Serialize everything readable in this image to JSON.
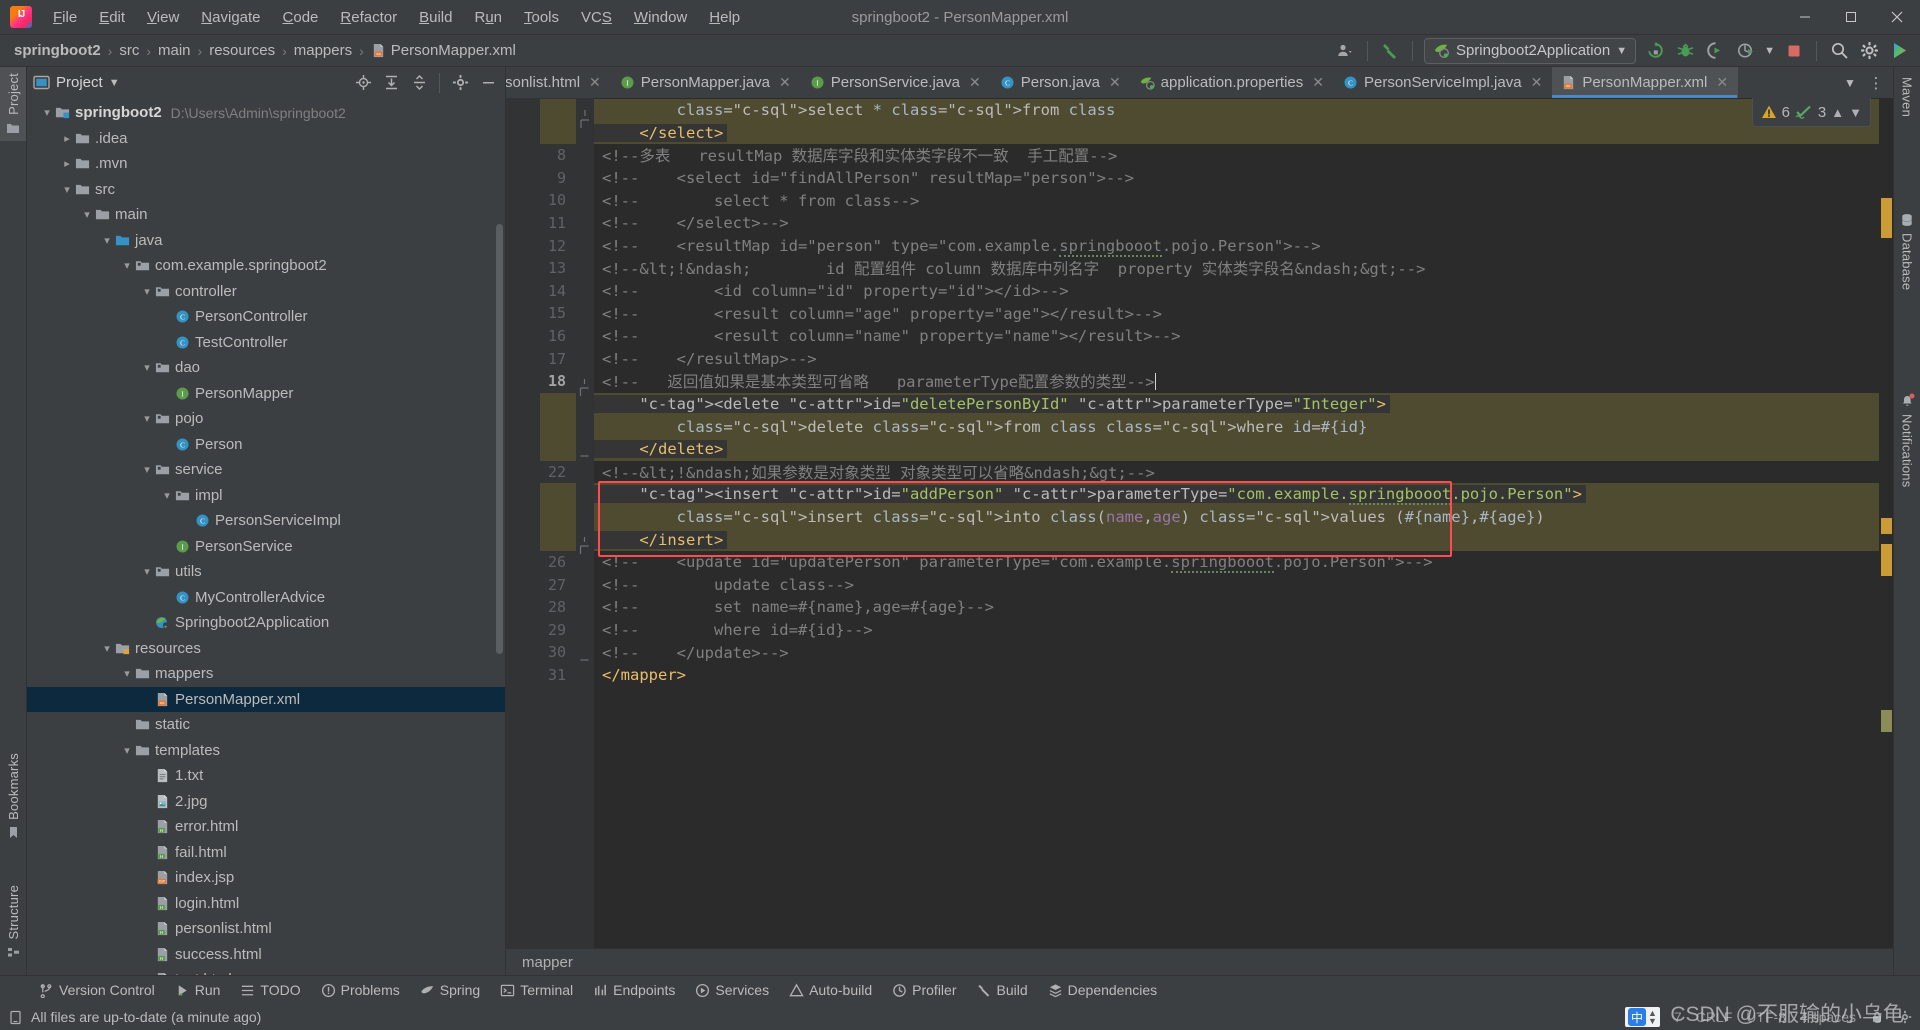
{
  "window": {
    "title": "springboot2 - PersonMapper.xml",
    "minimize_label": "—",
    "maximize_label": "❐",
    "close_label": "✕"
  },
  "menubar": {
    "logo": "intellij-idea-logo",
    "items": [
      {
        "label": "File",
        "mnemonic": "F"
      },
      {
        "label": "Edit",
        "mnemonic": "E"
      },
      {
        "label": "View",
        "mnemonic": "V"
      },
      {
        "label": "Navigate",
        "mnemonic": "N"
      },
      {
        "label": "Code",
        "mnemonic": "C"
      },
      {
        "label": "Refactor",
        "mnemonic": "R"
      },
      {
        "label": "Build",
        "mnemonic": "B"
      },
      {
        "label": "Run",
        "mnemonic": "u"
      },
      {
        "label": "Tools",
        "mnemonic": "T"
      },
      {
        "label": "VCS",
        "mnemonic": "S"
      },
      {
        "label": "Window",
        "mnemonic": "W"
      },
      {
        "label": "Help",
        "mnemonic": "H"
      }
    ]
  },
  "navbar": {
    "crumbs": [
      "springboot2",
      "src",
      "main",
      "resources",
      "mappers",
      "PersonMapper.xml"
    ],
    "separator": "›",
    "run_config": "Springboot2Application",
    "icons": [
      "user-accounts-icon",
      "hammer-build-icon",
      "rerun-icon",
      "debug-icon",
      "run-with-coverage-icon",
      "profile-icon",
      "stop-icon",
      "search-icon",
      "settings-gear-icon",
      "ide-assistant-icon"
    ]
  },
  "left_strip": {
    "tabs": [
      {
        "label": "Project",
        "icon": "project-folder-icon",
        "active": true
      },
      {
        "label": "Bookmarks",
        "icon": "bookmark-icon",
        "active": false
      },
      {
        "label": "Structure",
        "icon": "structure-icon",
        "active": false
      }
    ]
  },
  "right_strip": {
    "tabs": [
      {
        "label": "Maven",
        "icon": "maven-icon"
      },
      {
        "label": "Database",
        "icon": "database-icon"
      },
      {
        "label": "Notifications",
        "icon": "bell-icon",
        "badge": true
      }
    ]
  },
  "project_panel": {
    "title": "Project",
    "dropdown": "▾",
    "header_icons": [
      "select-opened-file-icon",
      "expand-all-icon",
      "collapse-all-icon",
      "settings-gear-icon",
      "hide-icon"
    ],
    "tree": [
      {
        "depth": 0,
        "arrow": "open",
        "icon": "module-icon",
        "label": "springboot2",
        "path": "D:\\Users\\Admin\\springboot2",
        "bold": true
      },
      {
        "depth": 1,
        "arrow": "closed",
        "icon": "folder-icon",
        "label": ".idea"
      },
      {
        "depth": 1,
        "arrow": "closed",
        "icon": "folder-icon",
        "label": ".mvn"
      },
      {
        "depth": 1,
        "arrow": "open",
        "icon": "folder-icon",
        "label": "src"
      },
      {
        "depth": 2,
        "arrow": "open",
        "icon": "folder-icon",
        "label": "main"
      },
      {
        "depth": 3,
        "arrow": "open",
        "icon": "source-root-icon",
        "label": "java"
      },
      {
        "depth": 4,
        "arrow": "open",
        "icon": "package-icon",
        "label": "com.example.springboot2"
      },
      {
        "depth": 5,
        "arrow": "open",
        "icon": "package-icon",
        "label": "controller"
      },
      {
        "depth": 6,
        "arrow": "none",
        "icon": "class-icon",
        "label": "PersonController"
      },
      {
        "depth": 6,
        "arrow": "none",
        "icon": "class-icon",
        "label": "TestController"
      },
      {
        "depth": 5,
        "arrow": "open",
        "icon": "package-icon",
        "label": "dao"
      },
      {
        "depth": 6,
        "arrow": "none",
        "icon": "interface-icon",
        "label": "PersonMapper"
      },
      {
        "depth": 5,
        "arrow": "open",
        "icon": "package-icon",
        "label": "pojo"
      },
      {
        "depth": 6,
        "arrow": "none",
        "icon": "class-icon",
        "label": "Person"
      },
      {
        "depth": 5,
        "arrow": "open",
        "icon": "package-icon",
        "label": "service"
      },
      {
        "depth": 6,
        "arrow": "open",
        "icon": "package-icon",
        "label": "impl"
      },
      {
        "depth": 7,
        "arrow": "none",
        "icon": "class-icon",
        "label": "PersonServiceImpl"
      },
      {
        "depth": 6,
        "arrow": "none",
        "icon": "interface-icon",
        "label": "PersonService"
      },
      {
        "depth": 5,
        "arrow": "open",
        "icon": "package-icon",
        "label": "utils"
      },
      {
        "depth": 6,
        "arrow": "none",
        "icon": "class-icon",
        "label": "MyControllerAdvice"
      },
      {
        "depth": 5,
        "arrow": "none",
        "icon": "spring-class-icon",
        "label": "Springboot2Application"
      },
      {
        "depth": 3,
        "arrow": "open",
        "icon": "resource-root-icon",
        "label": "resources"
      },
      {
        "depth": 4,
        "arrow": "open",
        "icon": "folder-icon",
        "label": "mappers"
      },
      {
        "depth": 5,
        "arrow": "none",
        "icon": "xml-file-icon",
        "label": "PersonMapper.xml",
        "selected": true
      },
      {
        "depth": 4,
        "arrow": "none",
        "icon": "folder-icon",
        "label": "static"
      },
      {
        "depth": 4,
        "arrow": "open",
        "icon": "folder-icon",
        "label": "templates"
      },
      {
        "depth": 5,
        "arrow": "none",
        "icon": "text-file-icon",
        "label": "1.txt"
      },
      {
        "depth": 5,
        "arrow": "none",
        "icon": "image-file-icon",
        "label": "2.jpg"
      },
      {
        "depth": 5,
        "arrow": "none",
        "icon": "html-file-icon",
        "label": "error.html"
      },
      {
        "depth": 5,
        "arrow": "none",
        "icon": "html-file-icon",
        "label": "fail.html"
      },
      {
        "depth": 5,
        "arrow": "none",
        "icon": "jsp-file-icon",
        "label": "index.jsp"
      },
      {
        "depth": 5,
        "arrow": "none",
        "icon": "html-file-icon",
        "label": "login.html"
      },
      {
        "depth": 5,
        "arrow": "none",
        "icon": "html-file-icon",
        "label": "personlist.html"
      },
      {
        "depth": 5,
        "arrow": "none",
        "icon": "html-file-icon",
        "label": "success.html"
      },
      {
        "depth": 5,
        "arrow": "none",
        "icon": "html-file-icon",
        "label": "test.html"
      }
    ]
  },
  "editor": {
    "tabs": [
      {
        "label": "sonlist.html",
        "icon": "html-file-icon",
        "active": false,
        "clipped": true
      },
      {
        "label": "PersonMapper.java",
        "icon": "interface-icon",
        "active": false
      },
      {
        "label": "PersonService.java",
        "icon": "interface-icon",
        "active": false
      },
      {
        "label": "Person.java",
        "icon": "class-icon",
        "active": false
      },
      {
        "label": "application.properties",
        "icon": "spring-properties-icon",
        "active": false
      },
      {
        "label": "PersonServiceImpl.java",
        "icon": "class-icon",
        "active": false
      },
      {
        "label": "PersonMapper.xml",
        "icon": "xml-file-icon",
        "active": true
      }
    ],
    "tab_overflow_icon": "chevron-down-icon",
    "tab_options_icon": "more-vertical-icon",
    "inspection": {
      "warning_count": "6",
      "ok_count": "3",
      "prev_icon": "chevron-up-icon",
      "next_icon": "chevron-down-icon"
    },
    "breadcrumb_bottom": "mapper",
    "first_line": 6,
    "cursor_line": 18,
    "lines": [
      {
        "n": 6,
        "kind": "sql-hl",
        "text": "        select * from class"
      },
      {
        "n": 7,
        "kind": "tag",
        "text": "    </select>"
      },
      {
        "n": 8,
        "kind": "comment",
        "text": "<!--多表   resultMap 数据库字段和实体类字段不一致  手工配置-->"
      },
      {
        "n": 9,
        "kind": "comment",
        "text": "<!--    <select id=\"findAllPerson\" resultMap=\"person\">-->"
      },
      {
        "n": 10,
        "kind": "comment",
        "text": "<!--        select * from class-->"
      },
      {
        "n": 11,
        "kind": "comment",
        "text": "<!--    </select>-->"
      },
      {
        "n": 12,
        "kind": "comment",
        "text": "<!--    <resultMap id=\"person\" type=\"com.example.springbooot.pojo.Person\">-->"
      },
      {
        "n": 13,
        "kind": "comment",
        "text": "<!--&lt;!&ndash;        id 配置组件 column 数据库中列名字  property 实体类字段名&ndash;&gt;-->"
      },
      {
        "n": 14,
        "kind": "comment",
        "text": "<!--        <id column=\"id\" property=\"id\"></id>-->"
      },
      {
        "n": 15,
        "kind": "comment",
        "text": "<!--        <result column=\"age\" property=\"age\"></result>-->"
      },
      {
        "n": 16,
        "kind": "comment",
        "text": "<!--        <result column=\"name\" property=\"name\"></result>-->"
      },
      {
        "n": 17,
        "kind": "comment",
        "text": "<!--    </resultMap>-->"
      },
      {
        "n": 18,
        "kind": "comment-cursor",
        "text": "<!--   返回值如果是基本类型可省略   parameterType配置参数的类型-->"
      },
      {
        "n": 19,
        "kind": "delete-open",
        "text": "    <delete id=\"deletePersonById\" parameterType=\"Integer\">"
      },
      {
        "n": 20,
        "kind": "sql-hl2",
        "text": "        delete from class where id=#{id}"
      },
      {
        "n": 21,
        "kind": "tag",
        "text": "    </delete>"
      },
      {
        "n": 22,
        "kind": "comment",
        "text": "<!--&lt;!&ndash;如果参数是对象类型 对象类型可以省略&ndash;&gt;-->"
      },
      {
        "n": 23,
        "kind": "insert-open",
        "text": "    <insert id=\"addPerson\" parameterType=\"com.example.springbooot.pojo.Person\">"
      },
      {
        "n": 24,
        "kind": "insert-sql",
        "text": "        insert into class(name,age) values (#{name},#{age})"
      },
      {
        "n": 25,
        "kind": "insert-close",
        "text": "    </insert>"
      },
      {
        "n": 26,
        "kind": "comment",
        "text": "<!--    <update id=\"updatePerson\" parameterType=\"com.example.springbooot.pojo.Person\">-->"
      },
      {
        "n": 27,
        "kind": "comment",
        "text": "<!--        update class-->"
      },
      {
        "n": 28,
        "kind": "comment",
        "text": "<!--        set name=#{name},age=#{age}-->"
      },
      {
        "n": 29,
        "kind": "comment",
        "text": "<!--        where id=#{id}-->"
      },
      {
        "n": 30,
        "kind": "comment",
        "text": "<!--    </update>-->"
      },
      {
        "n": 31,
        "kind": "tag",
        "text": "</mapper>"
      }
    ]
  },
  "bottom_tools": [
    {
      "label": "Version Control",
      "icon": "branch-icon"
    },
    {
      "label": "Run",
      "icon": "run-icon"
    },
    {
      "label": "TODO",
      "icon": "todo-icon"
    },
    {
      "label": "Problems",
      "icon": "problems-icon"
    },
    {
      "label": "Spring",
      "icon": "spring-leaf-icon"
    },
    {
      "label": "Terminal",
      "icon": "terminal-icon"
    },
    {
      "label": "Endpoints",
      "icon": "endpoints-icon"
    },
    {
      "label": "Services",
      "icon": "services-icon"
    },
    {
      "label": "Auto-build",
      "icon": "auto-build-icon"
    },
    {
      "label": "Profiler",
      "icon": "profiler-icon"
    },
    {
      "label": "Build",
      "icon": "build-hammer-icon"
    },
    {
      "label": "Dependencies",
      "icon": "dependencies-icon"
    }
  ],
  "statusbar": {
    "icon": "document-icon",
    "message": "All files are up-to-date (a minute ago)",
    "line_col": "7",
    "line_separator": "CRLF",
    "encoding": "UTF-8",
    "indent": "4 spaces",
    "ime_label": "中",
    "lock_icon": "lock-icon",
    "settings_icon": "settings-gear-icon",
    "watermark": "CSDN @不服输的小乌龟"
  },
  "colors": {
    "window_bg": "#3c3f41",
    "editor_bg": "#2b2b2b",
    "gutter_bg": "#313335",
    "accent_blue": "#4a88c7",
    "selection_blue": "#0d293e",
    "highlight_olive": "#4f4b31",
    "red_box": "#ff4d4f",
    "warning_yellow": "#d6a52b",
    "ok_green": "#59a869"
  }
}
